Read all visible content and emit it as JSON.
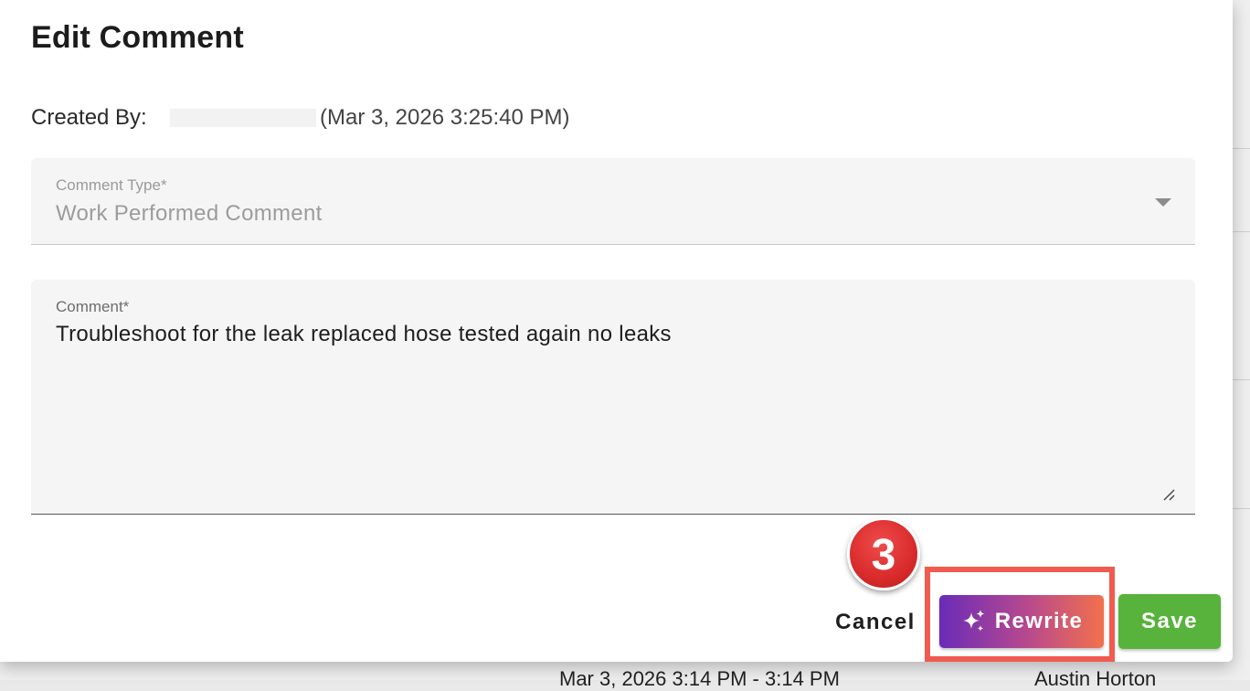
{
  "dialog": {
    "title": "Edit Comment",
    "created_by_label": "Created By:",
    "created_date": "(Mar 3, 2026 3:25:40 PM)"
  },
  "comment_type": {
    "label": "Comment Type*",
    "value": "Work Performed Comment"
  },
  "comment": {
    "label": "Comment*",
    "value": "Troubleshoot for the leak replaced hose tested again no leaks"
  },
  "actions": {
    "cancel_label": "Cancel",
    "rewrite_label": "Rewrite",
    "save_label": "Save"
  },
  "annotation": {
    "step_number": "3",
    "color": "#d92b2b"
  },
  "background_row": {
    "time_text": "Mar 3, 2026 3:14 PM - 3:14 PM",
    "person": "Austin Horton"
  },
  "colors": {
    "save": "#57b33b",
    "rewrite_gradient_start": "#6a2bb8",
    "rewrite_gradient_end": "#f2714b",
    "highlight": "#f15a4e"
  }
}
